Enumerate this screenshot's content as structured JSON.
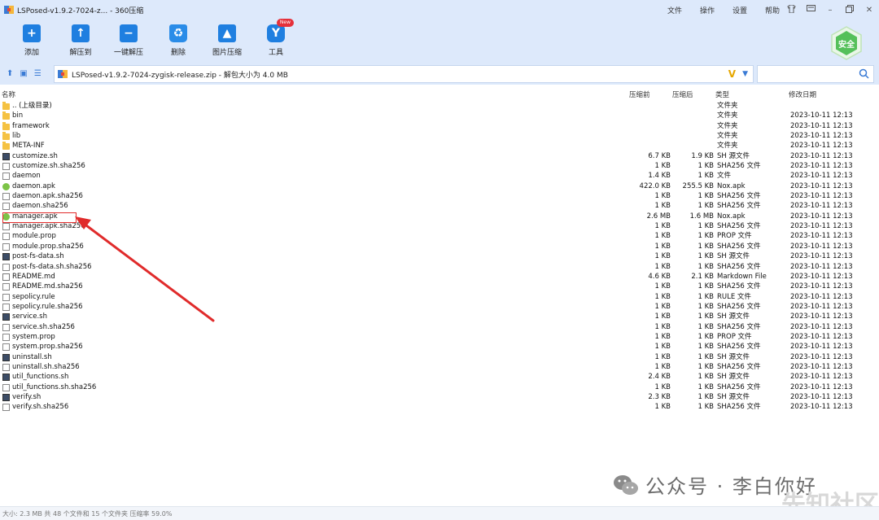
{
  "window": {
    "title": "LSPosed-v1.9.2-7024-z... - 360压缩",
    "menu": [
      "文件",
      "操作",
      "设置",
      "帮助"
    ]
  },
  "toolbar": {
    "items": [
      {
        "label": "添加",
        "icon": "plus-icon"
      },
      {
        "label": "解压到",
        "icon": "extract-to-icon"
      },
      {
        "label": "一键解压",
        "icon": "one-click-extract-icon"
      },
      {
        "label": "删除",
        "icon": "recycle-icon"
      },
      {
        "label": "图片压缩",
        "icon": "image-compress-icon"
      },
      {
        "label": "工具",
        "icon": "tools-icon",
        "badge": "New"
      }
    ],
    "safe_badge": "安全"
  },
  "address": {
    "path": "LSPosed-v1.9.2-7024-zygisk-release.zip - 解包大小为 4.0 MB",
    "search_placeholder": ""
  },
  "columns": {
    "name": "名称",
    "compressed": "压缩前",
    "original": "压缩后",
    "type": "类型",
    "date": "修改日期"
  },
  "files": [
    {
      "name": ".. (上级目录)",
      "comp": "",
      "orig": "",
      "type": "文件夹",
      "date": "",
      "icon": "folder"
    },
    {
      "name": "bin",
      "comp": "",
      "orig": "",
      "type": "文件夹",
      "date": "2023-10-11 12:13",
      "icon": "folder"
    },
    {
      "name": "framework",
      "comp": "",
      "orig": "",
      "type": "文件夹",
      "date": "2023-10-11 12:13",
      "icon": "folder"
    },
    {
      "name": "lib",
      "comp": "",
      "orig": "",
      "type": "文件夹",
      "date": "2023-10-11 12:13",
      "icon": "folder"
    },
    {
      "name": "META-INF",
      "comp": "",
      "orig": "",
      "type": "文件夹",
      "date": "2023-10-11 12:13",
      "icon": "folder"
    },
    {
      "name": "customize.sh",
      "comp": "6.7 KB",
      "orig": "1.9 KB",
      "type": "SH 源文件",
      "date": "2023-10-11 12:13",
      "icon": "sh"
    },
    {
      "name": "customize.sh.sha256",
      "comp": "1 KB",
      "orig": "1 KB",
      "type": "SHA256 文件",
      "date": "2023-10-11 12:13",
      "icon": "doc"
    },
    {
      "name": "daemon",
      "comp": "1.4 KB",
      "orig": "1 KB",
      "type": "文件",
      "date": "2023-10-11 12:13",
      "icon": "doc"
    },
    {
      "name": "daemon.apk",
      "comp": "422.0 KB",
      "orig": "255.5 KB",
      "type": "Nox.apk",
      "date": "2023-10-11 12:13",
      "icon": "apk"
    },
    {
      "name": "daemon.apk.sha256",
      "comp": "1 KB",
      "orig": "1 KB",
      "type": "SHA256 文件",
      "date": "2023-10-11 12:13",
      "icon": "doc"
    },
    {
      "name": "daemon.sha256",
      "comp": "1 KB",
      "orig": "1 KB",
      "type": "SHA256 文件",
      "date": "2023-10-11 12:13",
      "icon": "doc"
    },
    {
      "name": "manager.apk",
      "comp": "2.6 MB",
      "orig": "1.6 MB",
      "type": "Nox.apk",
      "date": "2023-10-11 12:13",
      "icon": "apk"
    },
    {
      "name": "manager.apk.sha256",
      "comp": "1 KB",
      "orig": "1 KB",
      "type": "SHA256 文件",
      "date": "2023-10-11 12:13",
      "icon": "doc"
    },
    {
      "name": "module.prop",
      "comp": "1 KB",
      "orig": "1 KB",
      "type": "PROP 文件",
      "date": "2023-10-11 12:13",
      "icon": "doc"
    },
    {
      "name": "module.prop.sha256",
      "comp": "1 KB",
      "orig": "1 KB",
      "type": "SHA256 文件",
      "date": "2023-10-11 12:13",
      "icon": "doc"
    },
    {
      "name": "post-fs-data.sh",
      "comp": "1 KB",
      "orig": "1 KB",
      "type": "SH 源文件",
      "date": "2023-10-11 12:13",
      "icon": "sh"
    },
    {
      "name": "post-fs-data.sh.sha256",
      "comp": "1 KB",
      "orig": "1 KB",
      "type": "SHA256 文件",
      "date": "2023-10-11 12:13",
      "icon": "doc"
    },
    {
      "name": "README.md",
      "comp": "4.6 KB",
      "orig": "2.1 KB",
      "type": "Markdown File",
      "date": "2023-10-11 12:13",
      "icon": "md"
    },
    {
      "name": "README.md.sha256",
      "comp": "1 KB",
      "orig": "1 KB",
      "type": "SHA256 文件",
      "date": "2023-10-11 12:13",
      "icon": "doc"
    },
    {
      "name": "sepolicy.rule",
      "comp": "1 KB",
      "orig": "1 KB",
      "type": "RULE 文件",
      "date": "2023-10-11 12:13",
      "icon": "doc"
    },
    {
      "name": "sepolicy.rule.sha256",
      "comp": "1 KB",
      "orig": "1 KB",
      "type": "SHA256 文件",
      "date": "2023-10-11 12:13",
      "icon": "doc"
    },
    {
      "name": "service.sh",
      "comp": "1 KB",
      "orig": "1 KB",
      "type": "SH 源文件",
      "date": "2023-10-11 12:13",
      "icon": "sh"
    },
    {
      "name": "service.sh.sha256",
      "comp": "1 KB",
      "orig": "1 KB",
      "type": "SHA256 文件",
      "date": "2023-10-11 12:13",
      "icon": "doc"
    },
    {
      "name": "system.prop",
      "comp": "1 KB",
      "orig": "1 KB",
      "type": "PROP 文件",
      "date": "2023-10-11 12:13",
      "icon": "doc"
    },
    {
      "name": "system.prop.sha256",
      "comp": "1 KB",
      "orig": "1 KB",
      "type": "SHA256 文件",
      "date": "2023-10-11 12:13",
      "icon": "doc"
    },
    {
      "name": "uninstall.sh",
      "comp": "1 KB",
      "orig": "1 KB",
      "type": "SH 源文件",
      "date": "2023-10-11 12:13",
      "icon": "sh"
    },
    {
      "name": "uninstall.sh.sha256",
      "comp": "1 KB",
      "orig": "1 KB",
      "type": "SHA256 文件",
      "date": "2023-10-11 12:13",
      "icon": "doc"
    },
    {
      "name": "util_functions.sh",
      "comp": "2.4 KB",
      "orig": "1 KB",
      "type": "SH 源文件",
      "date": "2023-10-11 12:13",
      "icon": "sh"
    },
    {
      "name": "util_functions.sh.sha256",
      "comp": "1 KB",
      "orig": "1 KB",
      "type": "SHA256 文件",
      "date": "2023-10-11 12:13",
      "icon": "doc"
    },
    {
      "name": "verify.sh",
      "comp": "2.3 KB",
      "orig": "1 KB",
      "type": "SH 源文件",
      "date": "2023-10-11 12:13",
      "icon": "sh"
    },
    {
      "name": "verify.sh.sha256",
      "comp": "1 KB",
      "orig": "1 KB",
      "type": "SHA256 文件",
      "date": "2023-10-11 12:13",
      "icon": "doc"
    }
  ],
  "status": "大小: 2.3 MB 共 48 个文件和 15 个文件夹 压缩率 59.0%",
  "watermark": {
    "text": "公众号 · 李白你好",
    "corner": "先知社区"
  },
  "colors": {
    "chrome": "#dde9fb",
    "accent": "#1f7fe0",
    "highlight": "#e02b2b"
  }
}
